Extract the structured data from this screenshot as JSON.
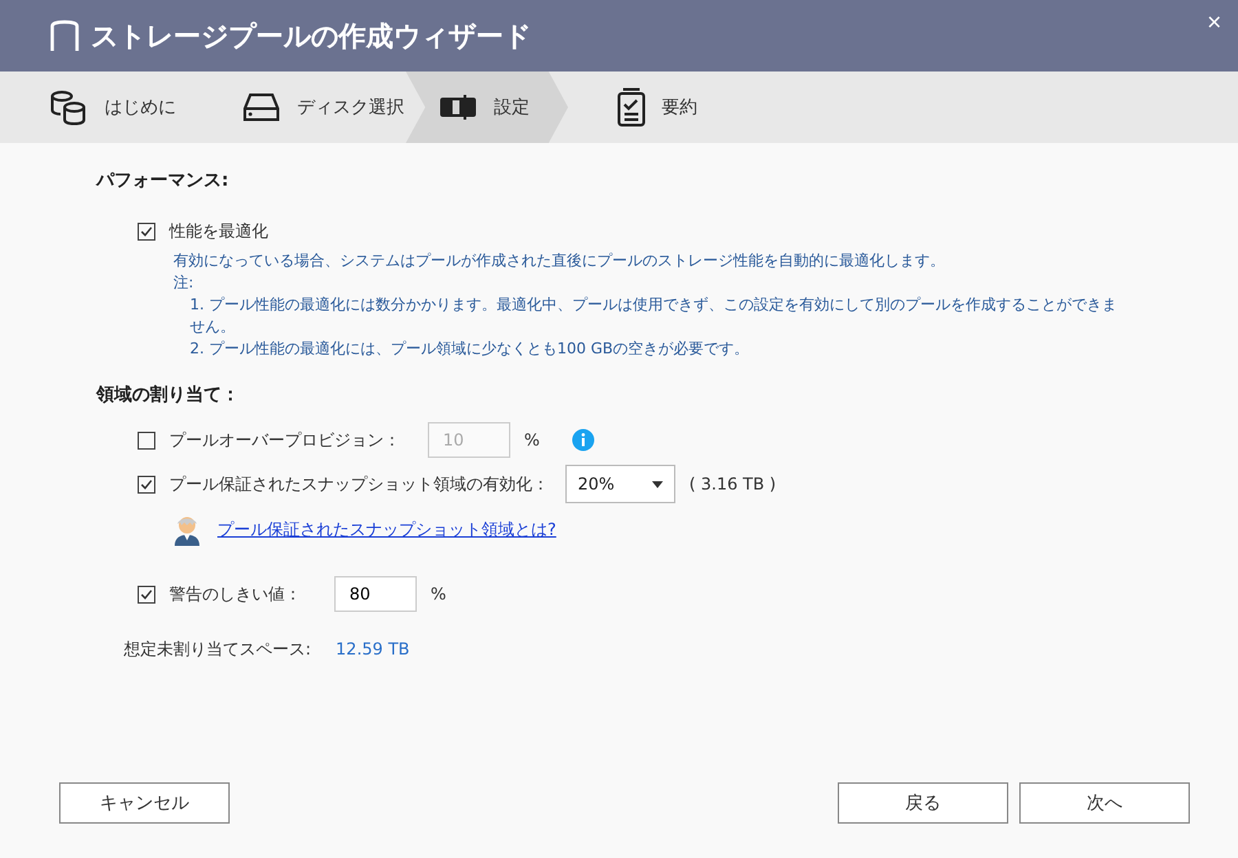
{
  "window": {
    "title": "ストレージプールの作成ウィザード",
    "close": "×"
  },
  "steps": [
    {
      "label": "はじめに",
      "kind": "intro",
      "selected": false
    },
    {
      "label": "ディスク選択",
      "kind": "disk",
      "selected": false
    },
    {
      "label": "設定",
      "kind": "settings",
      "selected": true
    },
    {
      "label": "要約",
      "kind": "summary",
      "selected": false
    }
  ],
  "performance": {
    "heading": "パフォーマンス:",
    "optimize": {
      "label": "性能を最適化",
      "checked": true
    },
    "description": "有効になっている場合、システムはプールが作成された直後にプールのストレージ性能を自動的に最適化します。",
    "note_label": "注:",
    "notes": [
      "1. プール性能の最適化には数分かかります。最適化中、プールは使用できず、この設定を有効にして別のプールを作成することができません。",
      "2. プール性能の最適化には、プール領域に少なくとも100 GBの空きが必要です。"
    ]
  },
  "allocation": {
    "heading": "領域の割り当て：",
    "overprovision": {
      "label": "プールオーバープロビジョン：",
      "checked": false,
      "value": "10",
      "unit": "%",
      "disabled": true
    },
    "snapshot": {
      "label": "プール保証されたスナップショット領域の有効化：",
      "checked": true,
      "value": "20%",
      "size": "( 3.16 TB )"
    },
    "help_link": "プール保証されたスナップショット領域とは?",
    "threshold": {
      "label": "警告のしきい値：",
      "checked": true,
      "value": "80",
      "unit": "%"
    },
    "unallocated": {
      "label": "想定未割り当てスペース:",
      "value": "12.59 TB"
    }
  },
  "buttons": {
    "cancel": "キャンセル",
    "back": "戻る",
    "next": "次へ"
  }
}
